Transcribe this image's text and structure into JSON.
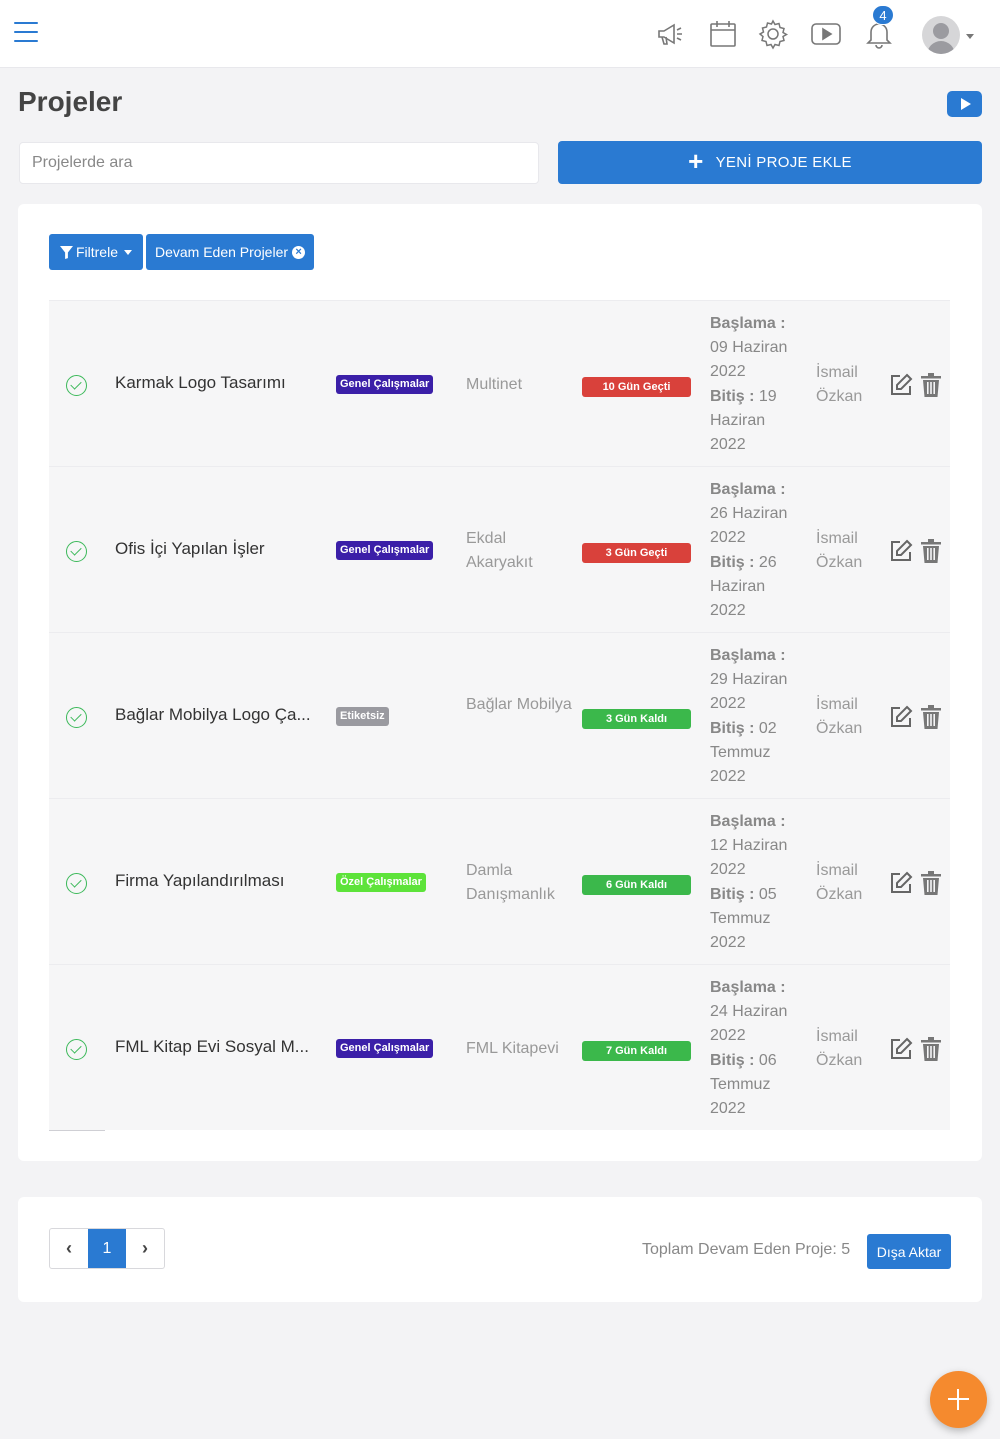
{
  "header": {
    "notification_count": "4",
    "icons": [
      "menu-icon",
      "megaphone-icon",
      "calendar-icon",
      "gear-icon",
      "video-icon",
      "bell-icon",
      "avatar"
    ]
  },
  "page": {
    "title": "Projeler",
    "search_placeholder": "Projelerde ara",
    "add_button": "YENİ PROJE EKLE",
    "filter_button": "Filtrele",
    "active_filter": "Devam Eden Projeler"
  },
  "projects": [
    {
      "name": "Karmak Logo Tasarımı",
      "tag": "Genel Çalışmalar",
      "tag_color": "#3b1fa8",
      "client": "Multinet",
      "status": "10 Gün Geçti",
      "status_color": "#d9413b",
      "start_label": "Başlama :",
      "start_date": "09 Haziran 2022",
      "end_label": "Bitiş :",
      "end_date": "19 Haziran 2022",
      "owner": "İsmail Özkan"
    },
    {
      "name": "Ofis İçi Yapılan İşler",
      "tag": "Genel Çalışmalar",
      "tag_color": "#3b1fa8",
      "client": "Ekdal Akaryakıt",
      "status": "3 Gün Geçti",
      "status_color": "#d9413b",
      "start_label": "Başlama :",
      "start_date": "26 Haziran 2022",
      "end_label": "Bitiş :",
      "end_date": "26 Haziran 2022",
      "owner": "İsmail Özkan"
    },
    {
      "name": "Bağlar Mobilya Logo Ça...",
      "tag": "Etiketsiz",
      "tag_color": "#9a9aa0",
      "client": "Bağlar Mobilya",
      "status": "3 Gün Kaldı",
      "status_color": "#3bb84b",
      "start_label": "Başlama :",
      "start_date": "29 Haziran 2022",
      "end_label": "Bitiş :",
      "end_date": "02 Temmuz 2022",
      "owner": "İsmail Özkan"
    },
    {
      "name": "Firma Yapılandırılması",
      "tag": "Özel Çalışmalar",
      "tag_color": "#5de33a",
      "client": "Damla Danışmanlık",
      "status": "6 Gün Kaldı",
      "status_color": "#3bb84b",
      "start_label": "Başlama :",
      "start_date": "12 Haziran 2022",
      "end_label": "Bitiş :",
      "end_date": "05 Temmuz 2022",
      "owner": "İsmail Özkan"
    },
    {
      "name": "FML Kitap Evi Sosyal M...",
      "tag": "Genel Çalışmalar",
      "tag_color": "#3b1fa8",
      "client": "FML Kitapevi",
      "status": "7 Gün Kaldı",
      "status_color": "#3bb84b",
      "start_label": "Başlama :",
      "start_date": "24 Haziran 2022",
      "end_label": "Bitiş :",
      "end_date": "06 Temmuz 2022",
      "owner": "İsmail Özkan"
    }
  ],
  "footer": {
    "prev": "‹",
    "current_page": "1",
    "next": "›",
    "total_text": "Toplam Devam Eden Proje: 5",
    "export_button": "Dışa Aktar"
  },
  "colors": {
    "primary": "#2a7ad2",
    "fab": "#f58a2e",
    "check": "#3cb95a"
  }
}
